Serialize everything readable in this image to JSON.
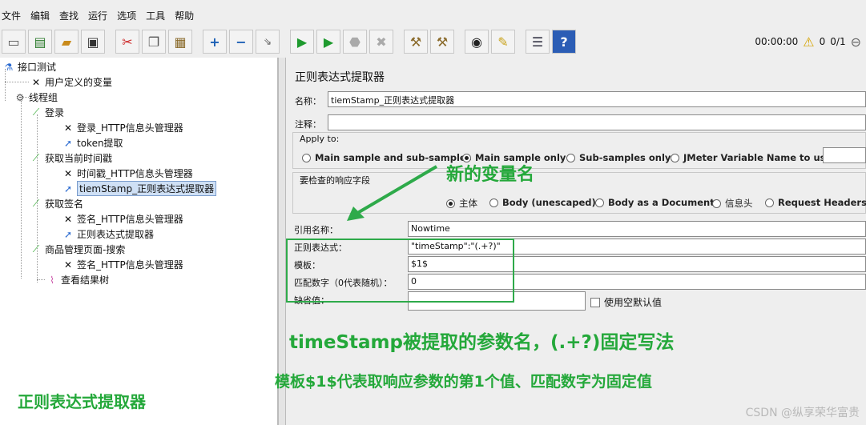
{
  "menu": [
    "文件",
    "编辑",
    "查找",
    "运行",
    "选项",
    "工具",
    "帮助"
  ],
  "toolbar": {
    "icons": [
      "new-icon",
      "templates-icon",
      "open-icon",
      "save-icon",
      "cut-icon",
      "copy-icon",
      "paste-icon",
      "expand-icon",
      "collapse-icon",
      "toggle-icon",
      "start-icon",
      "start-no-pause-icon",
      "stop-icon",
      "shutdown-icon",
      "clear-icon",
      "clear-all-icon",
      "search-icon",
      "reset-search-icon",
      "function-helper-icon",
      "help-icon"
    ],
    "elapsed": "00:00:00",
    "warnings": "0",
    "threads": "0/1"
  },
  "tree": {
    "items": [
      {
        "label": "接口测试",
        "icon": "test-plan-icon"
      },
      {
        "label": "用户定义的变量",
        "icon": "wrench-icon"
      },
      {
        "label": "线程组",
        "icon": "gear-icon"
      },
      {
        "label": "登录",
        "icon": "sampler-icon"
      },
      {
        "label": "登录_HTTP信息头管理器",
        "icon": "wrench-icon"
      },
      {
        "label": "token提取",
        "icon": "extractor-icon"
      },
      {
        "label": "获取当前时间戳",
        "icon": "sampler-icon"
      },
      {
        "label": "时间戳_HTTP信息头管理器",
        "icon": "wrench-icon"
      },
      {
        "label": "tiemStamp_正则表达式提取器",
        "icon": "extractor-icon"
      },
      {
        "label": "获取签名",
        "icon": "sampler-icon"
      },
      {
        "label": "签名_HTTP信息头管理器",
        "icon": "wrench-icon"
      },
      {
        "label": "正则表达式提取器",
        "icon": "extractor-icon"
      },
      {
        "label": "商品管理页面-搜索",
        "icon": "sampler-icon"
      },
      {
        "label": "签名_HTTP信息头管理器",
        "icon": "wrench-icon"
      },
      {
        "label": "查看结果树",
        "icon": "listener-icon"
      }
    ]
  },
  "panel": {
    "title": "正则表达式提取器",
    "name_label": "名称：",
    "name_value": "tiemStamp_正则表达式提取器",
    "comment_label": "注释：",
    "comment_value": "",
    "apply_to": {
      "legend": "Apply to:",
      "options": [
        "Main sample and sub-samples",
        "Main sample only",
        "Sub-samples only",
        "JMeter Variable Name to use"
      ],
      "selected": "Main sample only"
    },
    "field_check": {
      "legend": "要检查的响应字段",
      "options": [
        "主体",
        "Body (unescaped)",
        "Body as a Document",
        "信息头",
        "Request Headers"
      ],
      "selected": "主体"
    },
    "ref_name_label": "引用名称：",
    "ref_name_value": "Nowtime",
    "regex_label": "正则表达式：",
    "regex_value": "\"timeStamp\":\"(.+?)\"",
    "template_label": "模板：",
    "template_value": "$1$",
    "match_no_label": "匹配数字（0代表随机）：",
    "match_no_value": "0",
    "default_label": "缺省值：",
    "default_value": "",
    "use_empty_label": "使用空默认值"
  },
  "annotations": {
    "new_var": "新的变量名",
    "timestamp_note": "timeStamp被提取的参数名，(.+?)固定写法",
    "template_note": "模板$1$代表取响应参数的第1个值、匹配数字为固定值",
    "left_note": "正则表达式提取器",
    "color": "#24a83a"
  },
  "watermark": "CSDN @纵享荣华富贵"
}
